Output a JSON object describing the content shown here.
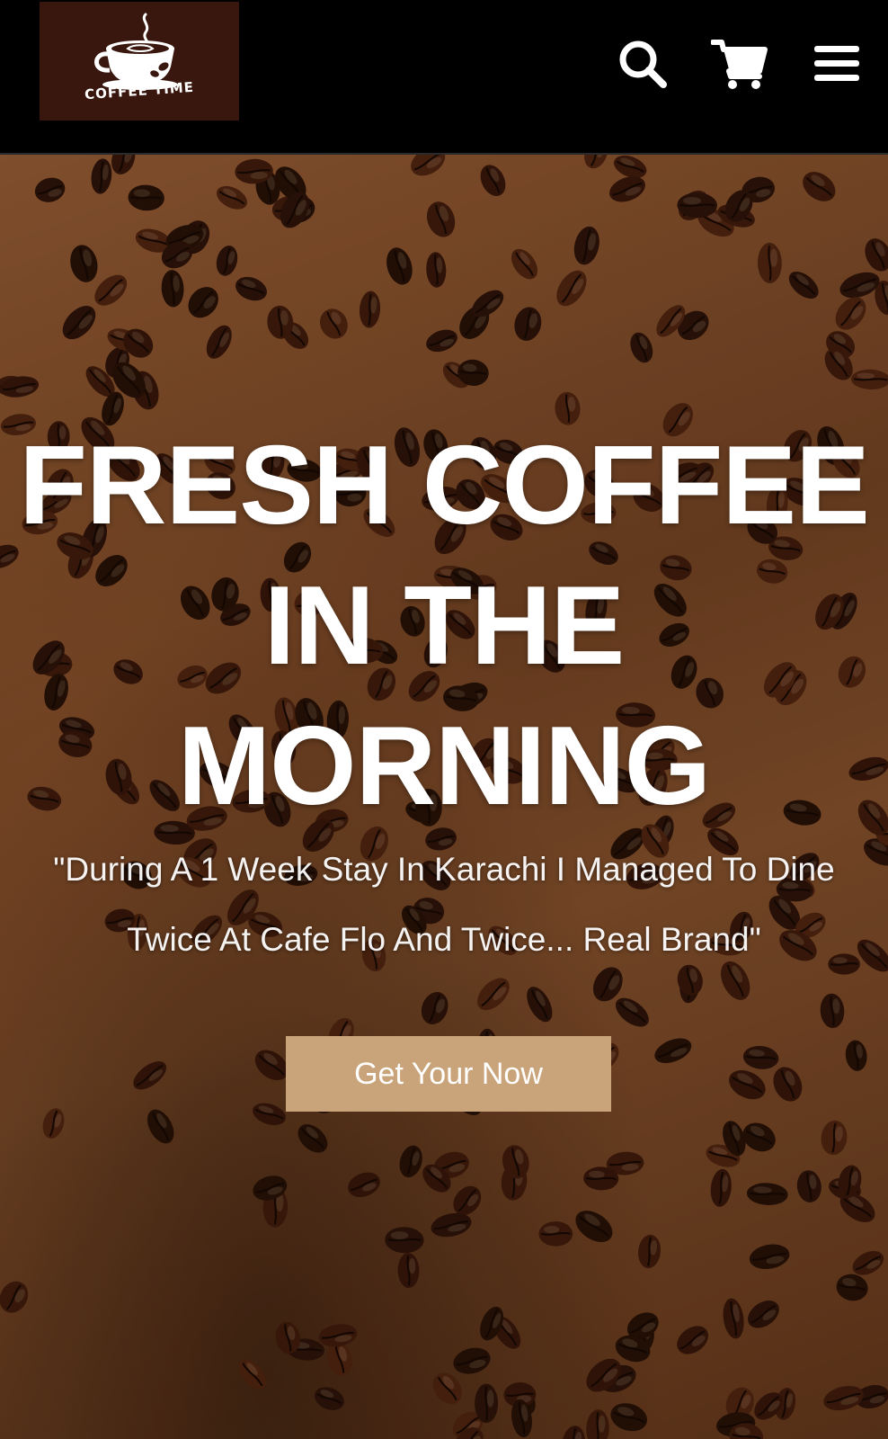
{
  "header": {
    "logo_text": "COFFEE TIME",
    "icons": [
      "search-icon",
      "cart-icon",
      "menu-icon"
    ]
  },
  "hero": {
    "title": "FRESH COFFEE IN THE MORNING",
    "quote": "\"During A 1 Week Stay In Karachi I Managed To Dine Twice At Cafe Flo And Twice... Real Brand\"",
    "cta_label": "Get Your Now"
  },
  "colors": {
    "header_bg": "#000000",
    "logo_bg": "#3a170e",
    "cta_bg": "#c9a47a",
    "text": "#ffffff"
  }
}
